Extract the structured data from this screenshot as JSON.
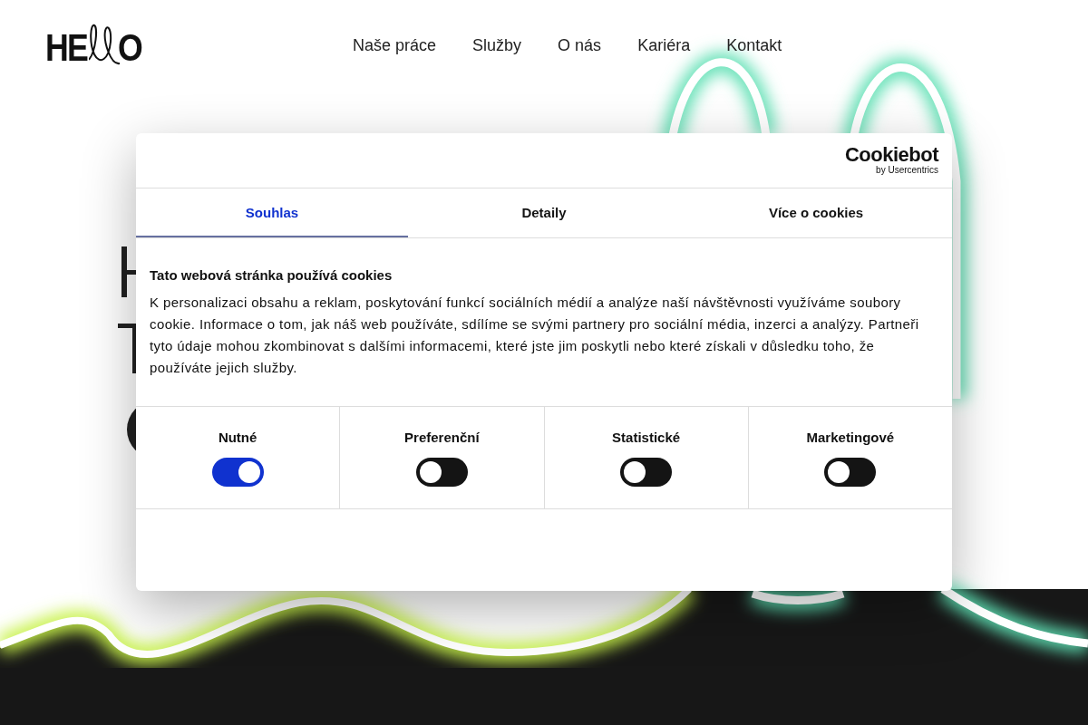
{
  "logo": {
    "start": "HE",
    "end": "O"
  },
  "nav": [
    {
      "label": "Naše práce"
    },
    {
      "label": "Služby"
    },
    {
      "label": "O nás"
    },
    {
      "label": "Kariéra"
    },
    {
      "label": "Kontakt"
    }
  ],
  "cookie_dialog": {
    "brand": "Cookiebot",
    "brand_sub": "by Usercentrics",
    "tabs": [
      {
        "label": "Souhlas",
        "selected": true
      },
      {
        "label": "Detaily",
        "selected": false
      },
      {
        "label": "Více o cookies",
        "selected": false
      }
    ],
    "heading": "Tato webová stránka používá cookies",
    "text": "K personalizaci obsahu a reklam, poskytování funkcí sociálních médií a analýze naší návštěvnosti využíváme soubory cookie. Informace o tom, jak náš web používáte, sdílíme se svými partnery pro sociální média, inzerci a analýzy. Partneři tyto údaje mohou zkombinovat s dalšími informacemi, které jste jim poskytli nebo které získali v důsledku toho, že používáte jejich služby.",
    "categories": [
      {
        "label": "Nutné",
        "on": true
      },
      {
        "label": "Preferenční",
        "on": false
      },
      {
        "label": "Statistické",
        "on": false
      },
      {
        "label": "Marketingové",
        "on": false
      }
    ]
  }
}
